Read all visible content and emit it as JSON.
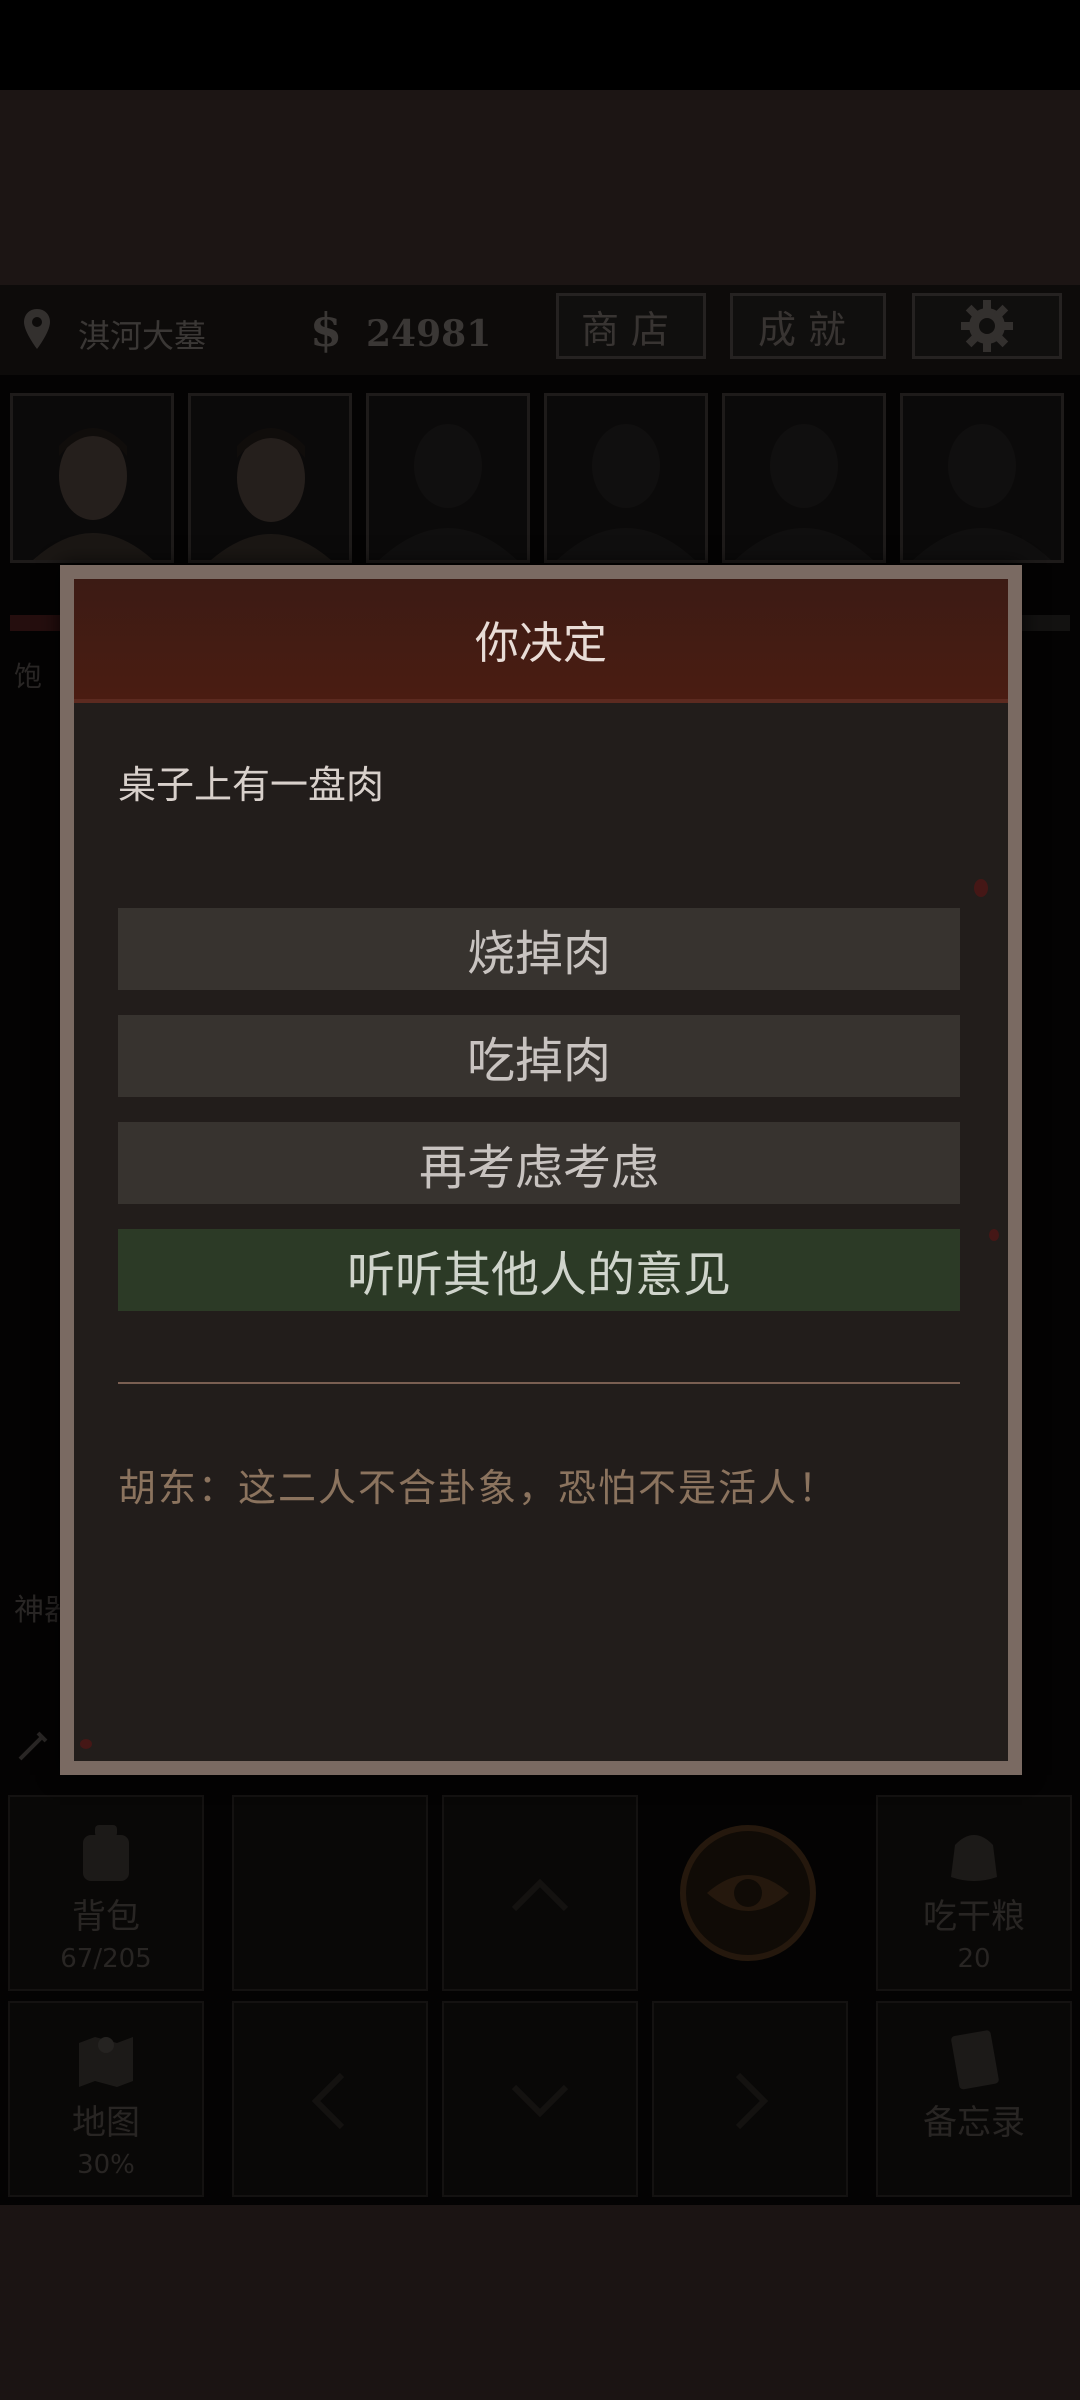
{
  "statusbar": {
    "location": "淇河大墓",
    "money_symbol": "$",
    "money": "24981",
    "shop_label": "商店",
    "achievements_label": "成就"
  },
  "side": {
    "left_label_1": "饱",
    "left_label_2": "神器"
  },
  "bottom": {
    "bag_label": "背包",
    "bag_count": "67/205",
    "eat_label": "吃干粮",
    "eat_count": "20",
    "map_label": "地图",
    "map_percent": "30%",
    "memo_label": "备忘录"
  },
  "modal": {
    "title": "你决定",
    "prompt": "桌子上有一盘肉",
    "choices": [
      {
        "label": "烧掉肉"
      },
      {
        "label": "吃掉肉"
      },
      {
        "label": "再考虑考虑"
      },
      {
        "label": "听听其他人的意见"
      }
    ],
    "advice": "胡东：这二人不合卦象，恐怕不是活人！"
  },
  "colors": {
    "header_red": "#4a1c12",
    "choice_grey": "#37332f",
    "choice_green": "#2c3a26",
    "advice_text": "#8b735e"
  }
}
